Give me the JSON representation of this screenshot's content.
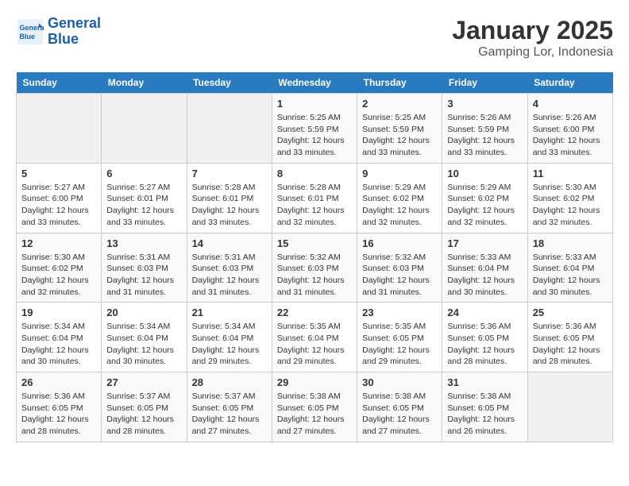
{
  "header": {
    "logo_line1": "General",
    "logo_line2": "Blue",
    "title": "January 2025",
    "subtitle": "Gamping Lor, Indonesia"
  },
  "days_of_week": [
    "Sunday",
    "Monday",
    "Tuesday",
    "Wednesday",
    "Thursday",
    "Friday",
    "Saturday"
  ],
  "weeks": [
    [
      {
        "day": "",
        "info": ""
      },
      {
        "day": "",
        "info": ""
      },
      {
        "day": "",
        "info": ""
      },
      {
        "day": "1",
        "info": "Sunrise: 5:25 AM\nSunset: 5:59 PM\nDaylight: 12 hours and 33 minutes."
      },
      {
        "day": "2",
        "info": "Sunrise: 5:25 AM\nSunset: 5:59 PM\nDaylight: 12 hours and 33 minutes."
      },
      {
        "day": "3",
        "info": "Sunrise: 5:26 AM\nSunset: 5:59 PM\nDaylight: 12 hours and 33 minutes."
      },
      {
        "day": "4",
        "info": "Sunrise: 5:26 AM\nSunset: 6:00 PM\nDaylight: 12 hours and 33 minutes."
      }
    ],
    [
      {
        "day": "5",
        "info": "Sunrise: 5:27 AM\nSunset: 6:00 PM\nDaylight: 12 hours and 33 minutes."
      },
      {
        "day": "6",
        "info": "Sunrise: 5:27 AM\nSunset: 6:01 PM\nDaylight: 12 hours and 33 minutes."
      },
      {
        "day": "7",
        "info": "Sunrise: 5:28 AM\nSunset: 6:01 PM\nDaylight: 12 hours and 33 minutes."
      },
      {
        "day": "8",
        "info": "Sunrise: 5:28 AM\nSunset: 6:01 PM\nDaylight: 12 hours and 32 minutes."
      },
      {
        "day": "9",
        "info": "Sunrise: 5:29 AM\nSunset: 6:02 PM\nDaylight: 12 hours and 32 minutes."
      },
      {
        "day": "10",
        "info": "Sunrise: 5:29 AM\nSunset: 6:02 PM\nDaylight: 12 hours and 32 minutes."
      },
      {
        "day": "11",
        "info": "Sunrise: 5:30 AM\nSunset: 6:02 PM\nDaylight: 12 hours and 32 minutes."
      }
    ],
    [
      {
        "day": "12",
        "info": "Sunrise: 5:30 AM\nSunset: 6:02 PM\nDaylight: 12 hours and 32 minutes."
      },
      {
        "day": "13",
        "info": "Sunrise: 5:31 AM\nSunset: 6:03 PM\nDaylight: 12 hours and 31 minutes."
      },
      {
        "day": "14",
        "info": "Sunrise: 5:31 AM\nSunset: 6:03 PM\nDaylight: 12 hours and 31 minutes."
      },
      {
        "day": "15",
        "info": "Sunrise: 5:32 AM\nSunset: 6:03 PM\nDaylight: 12 hours and 31 minutes."
      },
      {
        "day": "16",
        "info": "Sunrise: 5:32 AM\nSunset: 6:03 PM\nDaylight: 12 hours and 31 minutes."
      },
      {
        "day": "17",
        "info": "Sunrise: 5:33 AM\nSunset: 6:04 PM\nDaylight: 12 hours and 30 minutes."
      },
      {
        "day": "18",
        "info": "Sunrise: 5:33 AM\nSunset: 6:04 PM\nDaylight: 12 hours and 30 minutes."
      }
    ],
    [
      {
        "day": "19",
        "info": "Sunrise: 5:34 AM\nSunset: 6:04 PM\nDaylight: 12 hours and 30 minutes."
      },
      {
        "day": "20",
        "info": "Sunrise: 5:34 AM\nSunset: 6:04 PM\nDaylight: 12 hours and 30 minutes."
      },
      {
        "day": "21",
        "info": "Sunrise: 5:34 AM\nSunset: 6:04 PM\nDaylight: 12 hours and 29 minutes."
      },
      {
        "day": "22",
        "info": "Sunrise: 5:35 AM\nSunset: 6:04 PM\nDaylight: 12 hours and 29 minutes."
      },
      {
        "day": "23",
        "info": "Sunrise: 5:35 AM\nSunset: 6:05 PM\nDaylight: 12 hours and 29 minutes."
      },
      {
        "day": "24",
        "info": "Sunrise: 5:36 AM\nSunset: 6:05 PM\nDaylight: 12 hours and 28 minutes."
      },
      {
        "day": "25",
        "info": "Sunrise: 5:36 AM\nSunset: 6:05 PM\nDaylight: 12 hours and 28 minutes."
      }
    ],
    [
      {
        "day": "26",
        "info": "Sunrise: 5:36 AM\nSunset: 6:05 PM\nDaylight: 12 hours and 28 minutes."
      },
      {
        "day": "27",
        "info": "Sunrise: 5:37 AM\nSunset: 6:05 PM\nDaylight: 12 hours and 28 minutes."
      },
      {
        "day": "28",
        "info": "Sunrise: 5:37 AM\nSunset: 6:05 PM\nDaylight: 12 hours and 27 minutes."
      },
      {
        "day": "29",
        "info": "Sunrise: 5:38 AM\nSunset: 6:05 PM\nDaylight: 12 hours and 27 minutes."
      },
      {
        "day": "30",
        "info": "Sunrise: 5:38 AM\nSunset: 6:05 PM\nDaylight: 12 hours and 27 minutes."
      },
      {
        "day": "31",
        "info": "Sunrise: 5:38 AM\nSunset: 6:05 PM\nDaylight: 12 hours and 26 minutes."
      },
      {
        "day": "",
        "info": ""
      }
    ]
  ]
}
